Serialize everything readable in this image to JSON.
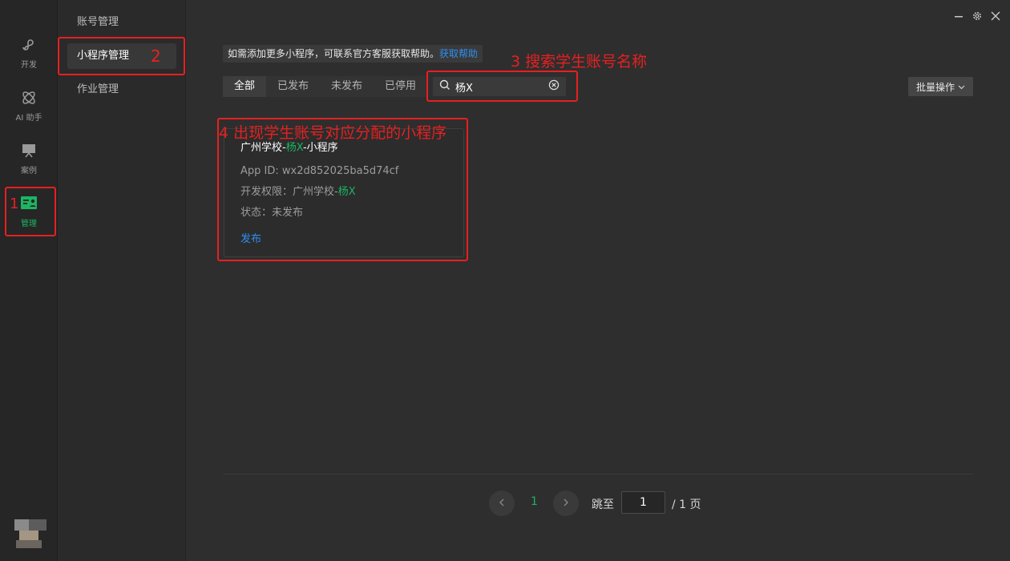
{
  "rail": {
    "items": [
      {
        "label": "开发",
        "icon": "code-icon"
      },
      {
        "label": "AI 助手",
        "icon": "atom-icon"
      },
      {
        "label": "案例",
        "icon": "easel-icon"
      },
      {
        "label": "管理",
        "icon": "manage-icon"
      }
    ],
    "active_index": 3
  },
  "nav": {
    "items": [
      {
        "label": "账号管理"
      },
      {
        "label": "小程序管理"
      },
      {
        "label": "作业管理"
      }
    ],
    "active_index": 1
  },
  "window_controls": {
    "minimize": "minimize-icon",
    "settings": "settings-icon",
    "close": "close-icon"
  },
  "notice": {
    "text": "如需添加更多小程序，可联系官方客服获取帮助。",
    "link": "获取帮助"
  },
  "tabs": [
    {
      "label": "全部"
    },
    {
      "label": "已发布"
    },
    {
      "label": "未发布"
    },
    {
      "label": "已停用"
    }
  ],
  "tabs_active_index": 0,
  "search": {
    "value": "杨X",
    "placeholder": ""
  },
  "batch_button": "批量操作",
  "card": {
    "title_prefix": "广州学校-",
    "title_highlight": "杨X",
    "title_suffix": "-小程序",
    "app_id_label": "App ID:",
    "app_id_value": "wx2d852025ba5d74cf",
    "permission_label": "开发权限：",
    "permission_prefix": "广州学校-",
    "permission_highlight": "杨X",
    "status_label": "状态：",
    "status_value": "未发布",
    "action": "发布"
  },
  "pagination": {
    "current": "1",
    "jump_label": "跳至",
    "jump_value": "1",
    "total": "/ 1 页"
  },
  "annotations": [
    {
      "text": "1"
    },
    {
      "text": "2"
    },
    {
      "text": "3 搜索学生账号名称"
    },
    {
      "text": "4 出现学生账号对应分配的小程序"
    }
  ],
  "colors": {
    "accent": "#1db462",
    "link": "#2e8ff0",
    "annotation": "#e62020",
    "background": "#2e2e2e"
  }
}
